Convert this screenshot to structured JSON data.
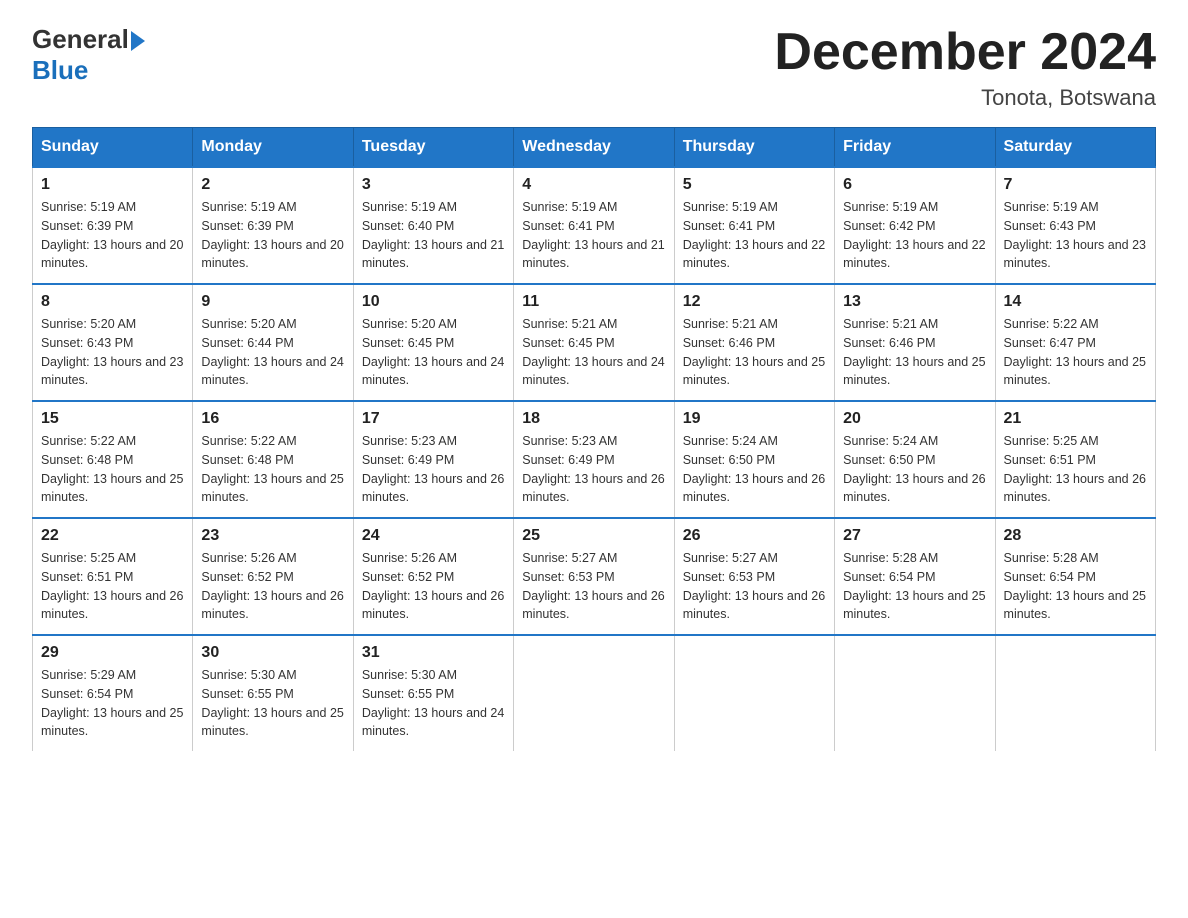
{
  "header": {
    "logo_general": "General",
    "logo_blue": "Blue",
    "month_title": "December 2024",
    "location": "Tonota, Botswana"
  },
  "days_of_week": [
    "Sunday",
    "Monday",
    "Tuesday",
    "Wednesday",
    "Thursday",
    "Friday",
    "Saturday"
  ],
  "weeks": [
    [
      {
        "day": "1",
        "sunrise": "5:19 AM",
        "sunset": "6:39 PM",
        "daylight": "13 hours and 20 minutes."
      },
      {
        "day": "2",
        "sunrise": "5:19 AM",
        "sunset": "6:39 PM",
        "daylight": "13 hours and 20 minutes."
      },
      {
        "day": "3",
        "sunrise": "5:19 AM",
        "sunset": "6:40 PM",
        "daylight": "13 hours and 21 minutes."
      },
      {
        "day": "4",
        "sunrise": "5:19 AM",
        "sunset": "6:41 PM",
        "daylight": "13 hours and 21 minutes."
      },
      {
        "day": "5",
        "sunrise": "5:19 AM",
        "sunset": "6:41 PM",
        "daylight": "13 hours and 22 minutes."
      },
      {
        "day": "6",
        "sunrise": "5:19 AM",
        "sunset": "6:42 PM",
        "daylight": "13 hours and 22 minutes."
      },
      {
        "day": "7",
        "sunrise": "5:19 AM",
        "sunset": "6:43 PM",
        "daylight": "13 hours and 23 minutes."
      }
    ],
    [
      {
        "day": "8",
        "sunrise": "5:20 AM",
        "sunset": "6:43 PM",
        "daylight": "13 hours and 23 minutes."
      },
      {
        "day": "9",
        "sunrise": "5:20 AM",
        "sunset": "6:44 PM",
        "daylight": "13 hours and 24 minutes."
      },
      {
        "day": "10",
        "sunrise": "5:20 AM",
        "sunset": "6:45 PM",
        "daylight": "13 hours and 24 minutes."
      },
      {
        "day": "11",
        "sunrise": "5:21 AM",
        "sunset": "6:45 PM",
        "daylight": "13 hours and 24 minutes."
      },
      {
        "day": "12",
        "sunrise": "5:21 AM",
        "sunset": "6:46 PM",
        "daylight": "13 hours and 25 minutes."
      },
      {
        "day": "13",
        "sunrise": "5:21 AM",
        "sunset": "6:46 PM",
        "daylight": "13 hours and 25 minutes."
      },
      {
        "day": "14",
        "sunrise": "5:22 AM",
        "sunset": "6:47 PM",
        "daylight": "13 hours and 25 minutes."
      }
    ],
    [
      {
        "day": "15",
        "sunrise": "5:22 AM",
        "sunset": "6:48 PM",
        "daylight": "13 hours and 25 minutes."
      },
      {
        "day": "16",
        "sunrise": "5:22 AM",
        "sunset": "6:48 PM",
        "daylight": "13 hours and 25 minutes."
      },
      {
        "day": "17",
        "sunrise": "5:23 AM",
        "sunset": "6:49 PM",
        "daylight": "13 hours and 26 minutes."
      },
      {
        "day": "18",
        "sunrise": "5:23 AM",
        "sunset": "6:49 PM",
        "daylight": "13 hours and 26 minutes."
      },
      {
        "day": "19",
        "sunrise": "5:24 AM",
        "sunset": "6:50 PM",
        "daylight": "13 hours and 26 minutes."
      },
      {
        "day": "20",
        "sunrise": "5:24 AM",
        "sunset": "6:50 PM",
        "daylight": "13 hours and 26 minutes."
      },
      {
        "day": "21",
        "sunrise": "5:25 AM",
        "sunset": "6:51 PM",
        "daylight": "13 hours and 26 minutes."
      }
    ],
    [
      {
        "day": "22",
        "sunrise": "5:25 AM",
        "sunset": "6:51 PM",
        "daylight": "13 hours and 26 minutes."
      },
      {
        "day": "23",
        "sunrise": "5:26 AM",
        "sunset": "6:52 PM",
        "daylight": "13 hours and 26 minutes."
      },
      {
        "day": "24",
        "sunrise": "5:26 AM",
        "sunset": "6:52 PM",
        "daylight": "13 hours and 26 minutes."
      },
      {
        "day": "25",
        "sunrise": "5:27 AM",
        "sunset": "6:53 PM",
        "daylight": "13 hours and 26 minutes."
      },
      {
        "day": "26",
        "sunrise": "5:27 AM",
        "sunset": "6:53 PM",
        "daylight": "13 hours and 26 minutes."
      },
      {
        "day": "27",
        "sunrise": "5:28 AM",
        "sunset": "6:54 PM",
        "daylight": "13 hours and 25 minutes."
      },
      {
        "day": "28",
        "sunrise": "5:28 AM",
        "sunset": "6:54 PM",
        "daylight": "13 hours and 25 minutes."
      }
    ],
    [
      {
        "day": "29",
        "sunrise": "5:29 AM",
        "sunset": "6:54 PM",
        "daylight": "13 hours and 25 minutes."
      },
      {
        "day": "30",
        "sunrise": "5:30 AM",
        "sunset": "6:55 PM",
        "daylight": "13 hours and 25 minutes."
      },
      {
        "day": "31",
        "sunrise": "5:30 AM",
        "sunset": "6:55 PM",
        "daylight": "13 hours and 24 minutes."
      },
      null,
      null,
      null,
      null
    ]
  ],
  "labels": {
    "sunrise_prefix": "Sunrise: ",
    "sunset_prefix": "Sunset: ",
    "daylight_prefix": "Daylight: "
  }
}
